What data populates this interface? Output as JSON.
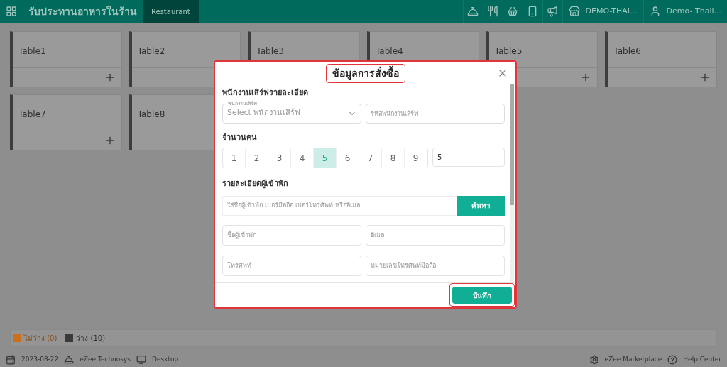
{
  "header": {
    "title": "รับประทานอาหารในร้าน",
    "tabs": [
      {
        "label": "Restaurant",
        "selected": true
      }
    ],
    "property": "DEMO-THAI...",
    "user": "Demo- Thail..."
  },
  "tables": [
    {
      "name": "Table1"
    },
    {
      "name": "Table2"
    },
    {
      "name": "Table3"
    },
    {
      "name": "Table4"
    },
    {
      "name": "Table5"
    },
    {
      "name": "Table6"
    },
    {
      "name": "Table7"
    },
    {
      "name": "Table8"
    }
  ],
  "modal": {
    "title": "ข้อมูลการสั่งซื้อ",
    "waiter_section": "พนักงานเสิร์ฟรายละเอียด",
    "waiter_select": {
      "label": "พนักงานเสิร์ฟ",
      "placeholder": "Select พนักงานเสิร์ฟ"
    },
    "waiter_code": {
      "placeholder": "รหัสพนักงานเสิร์ฟ"
    },
    "pax_section": "จำนวนคน",
    "pax_options": [
      {
        "label": "1",
        "selected": false
      },
      {
        "label": "2",
        "selected": false
      },
      {
        "label": "3",
        "selected": false
      },
      {
        "label": "4",
        "selected": false
      },
      {
        "label": "5",
        "selected": true
      },
      {
        "label": "6",
        "selected": false
      },
      {
        "label": "7",
        "selected": false
      },
      {
        "label": "8",
        "selected": false
      },
      {
        "label": "9",
        "selected": false
      }
    ],
    "pax_value": "5",
    "guest_section": "รายละเอียดผู้เข้าพัก",
    "guest_search": {
      "placeholder": "ใส่ชื่อผู้เข้าพัก เบอร์มือถือ เบอร์โทรศัพท์ หรืออีเมล"
    },
    "search_button": "ค้นหา",
    "guest_fields": [
      {
        "placeholder": "ชื่อผู้เข้าพัก"
      },
      {
        "placeholder": "อีเมล"
      },
      {
        "placeholder": "โทรศัพท์"
      },
      {
        "placeholder": "หมายเลขโทรศัพท์มือถือ"
      }
    ],
    "save_button": "บันทึก"
  },
  "legend": [
    {
      "label": "ไม่ว่าง (0)",
      "color": "#c8701c"
    },
    {
      "label": "ว่าง (10)",
      "color": "#3a3a3a"
    }
  ],
  "status_bar": {
    "date": "2023-08-22",
    "company": "eZee Technosys",
    "device": "Desktop",
    "marketplace": "eZee Marketplace",
    "help": "Help Center"
  }
}
